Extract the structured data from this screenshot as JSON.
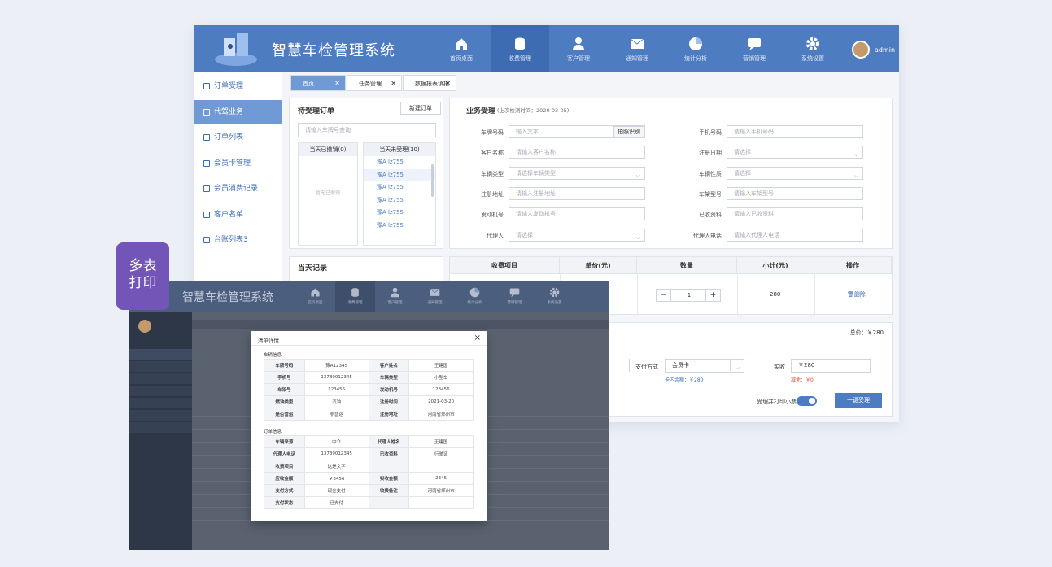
{
  "app": {
    "title": "智慧车检管理系统",
    "user": "admin"
  },
  "nav": [
    {
      "label": "首页桌面",
      "icon": "home-icon"
    },
    {
      "label": "收费管理",
      "icon": "coins-icon",
      "active": true
    },
    {
      "label": "客户管理",
      "icon": "user-icon"
    },
    {
      "label": "通知管理",
      "icon": "mail-icon"
    },
    {
      "label": "统计分析",
      "icon": "pie-chart-icon"
    },
    {
      "label": "营销管理",
      "icon": "chat-icon"
    },
    {
      "label": "系统设置",
      "icon": "gear-icon"
    }
  ],
  "sidebar": [
    {
      "label": "订单受理"
    },
    {
      "label": "代驾业务",
      "active": true
    },
    {
      "label": "订单列表"
    },
    {
      "label": "会员卡管理"
    },
    {
      "label": "会员消费记录"
    },
    {
      "label": "客户名单"
    },
    {
      "label": "台账列表3"
    }
  ],
  "tabs": [
    {
      "label": "首页"
    },
    {
      "label": "任务管理"
    },
    {
      "label": "数据报表填报"
    }
  ],
  "pending": {
    "title": "待受理订单",
    "new_btn": "新建订单",
    "search_ph": "请输入车牌号查询",
    "col_cancel": "当天已撤销(0)",
    "col_unaccepted": "当天未受理(10)",
    "empty": "暂无已撤销",
    "plates": [
      "豫A lz755",
      "豫A lz755",
      "豫A lz755",
      "豫A lz755",
      "豫A lz755",
      "豫A lz755"
    ]
  },
  "business": {
    "title": "业务受理",
    "subtitle": "(上次检测时间：2020-03-05)",
    "left": [
      {
        "label": "车牌号码",
        "ph": "输入文本",
        "btn": "拍照识别"
      },
      {
        "label": "客户名称",
        "ph": "请输入客户名称"
      },
      {
        "label": "车辆类型",
        "ph": "请选择车辆类型",
        "select": true
      },
      {
        "label": "注册地址",
        "ph": "请输入注册地址"
      },
      {
        "label": "发动机号",
        "ph": "请输入发动机号"
      },
      {
        "label": "代理人",
        "ph": "请选择",
        "select": true
      }
    ],
    "right": [
      {
        "label": "手机号码",
        "ph": "请输入手机号码"
      },
      {
        "label": "注册日期",
        "ph": "请选择",
        "select": true
      },
      {
        "label": "车辆性质",
        "ph": "请选择",
        "select": true
      },
      {
        "label": "车架型号",
        "ph": "请输入车架型号"
      },
      {
        "label": "已收资料",
        "ph": "请输入已收资料"
      },
      {
        "label": "代理人电话",
        "ph": "请输入代理人电话"
      }
    ]
  },
  "today": {
    "title": "当天记录"
  },
  "fees": {
    "headers": [
      "收费项目",
      "单价(元)",
      "数量",
      "小计(元)",
      "操作"
    ],
    "qty": "1",
    "subtotal": "280",
    "delete": "删除",
    "minus": "−",
    "plus": "+"
  },
  "total": {
    "label": "总价：￥280",
    "pay_label": "支付方式",
    "pay_value": "会员卡",
    "card_balance": "卡内余额：￥280",
    "paid_label": "实收",
    "paid_value": "￥280",
    "discount": "减免：￥0",
    "print_label": "受理并打印小票",
    "accept_btn": "一键受理"
  },
  "badge": {
    "line1": "多表",
    "line2": "打印"
  },
  "overlay": {
    "title": "智慧车检管理系统",
    "modal_title": "清单详情",
    "close": "×",
    "sec1": "车辆信息",
    "rows1": [
      [
        "车牌号码",
        "豫A12345",
        "客户姓名",
        "王建国"
      ],
      [
        "手机号",
        "13789012345",
        "车辆类型",
        "小型车"
      ],
      [
        "车架号",
        "123456",
        "发动机号",
        "123456"
      ],
      [
        "燃油类型",
        "汽油",
        "注册时间",
        "2021-03-20"
      ],
      [
        "是否营运",
        "非营运",
        "注册地址",
        "河南省郑州市"
      ]
    ],
    "sec2": "订单信息",
    "rows2": [
      [
        "车辆来源",
        "中介",
        "代理人姓名",
        "王建国"
      ],
      [
        "代理人电话",
        "13789012345",
        "已收资料",
        "行驶证"
      ],
      [
        "收费项目",
        "这是文字",
        "",
        ""
      ],
      [
        "应收金额",
        "￥3456",
        "实收金额",
        "2345"
      ],
      [
        "支付方式",
        "现金支付",
        "收费备注",
        "河南省郑州市"
      ],
      [
        "支付状态",
        "已支付",
        "",
        ""
      ]
    ]
  }
}
